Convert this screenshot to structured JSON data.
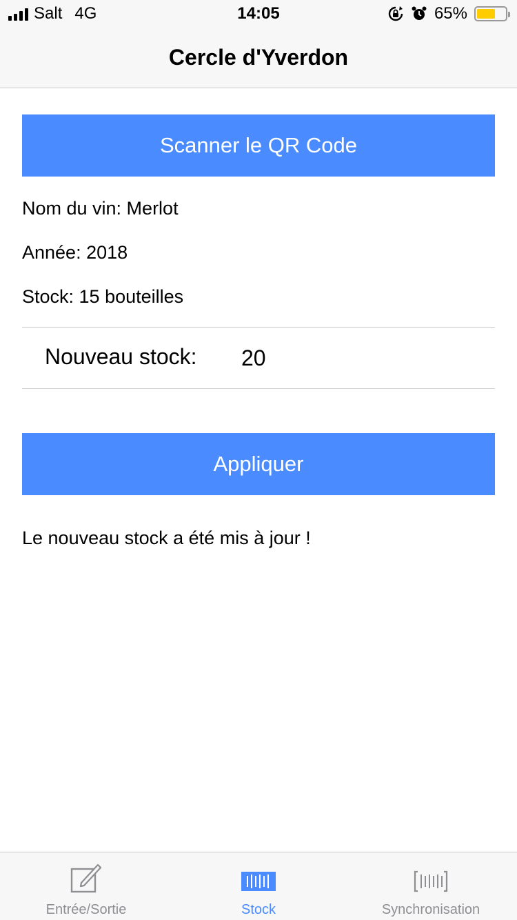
{
  "status_bar": {
    "carrier": "Salt",
    "network": "4G",
    "time": "14:05",
    "battery_percent": "65%",
    "battery_level": 0.65,
    "battery_color": "#ffcc00"
  },
  "nav": {
    "title": "Cercle d'Yverdon"
  },
  "main": {
    "scan_button_label": "Scanner le QR Code",
    "wine_name": "Nom du vin: Merlot",
    "year": "Année: 2018",
    "stock": "Stock: 15 bouteilles",
    "new_stock_label": "Nouveau stock:",
    "new_stock_value": "20",
    "apply_button_label": "Appliquer",
    "result_message": "Le nouveau stock a été mis à jour !"
  },
  "tab_bar": {
    "tabs": [
      {
        "label": "Entrée/Sortie",
        "icon": "compose-icon",
        "active": false
      },
      {
        "label": "Stock",
        "icon": "barcode-icon",
        "active": true
      },
      {
        "label": "Synchronisation",
        "icon": "barcode-sync-icon",
        "active": false
      }
    ]
  },
  "colors": {
    "accent": "#4a8cff",
    "inactive_tab": "#8e8e93"
  }
}
